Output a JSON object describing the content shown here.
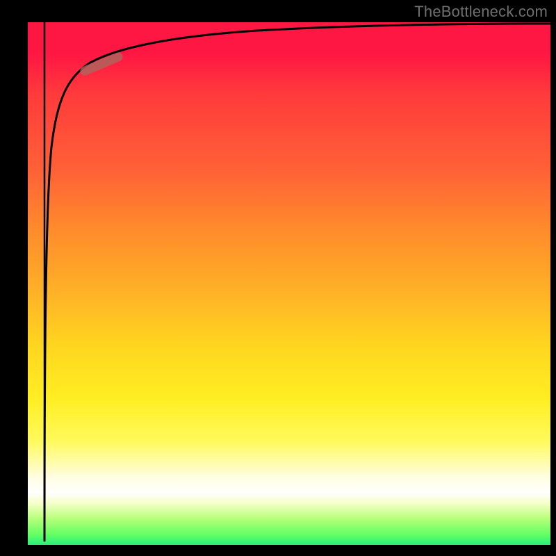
{
  "attribution": "TheBottleneck.com",
  "colors": {
    "page_bg": "#000000",
    "attribution_text": "#6f6f6f",
    "curve": "#000000",
    "marker": "#a9695f",
    "gradient_top": "#ff1744",
    "gradient_bottom": "#28f07a"
  },
  "chart_data": {
    "type": "line",
    "title": "",
    "xlabel": "",
    "ylabel": "",
    "xlim": [
      0,
      100
    ],
    "ylim": [
      0,
      100
    ],
    "series": [
      {
        "name": "curve",
        "x": [
          3,
          3.5,
          4,
          5,
          7,
          10,
          14,
          20,
          30,
          45,
          65,
          85,
          100
        ],
        "y": [
          0,
          50,
          70,
          80,
          86,
          90,
          92.5,
          94.5,
          96.2,
          97.4,
          98.3,
          98.9,
          99.3
        ]
      }
    ],
    "marker": {
      "x_range": [
        11,
        17
      ],
      "y_range": [
        91,
        93.5
      ]
    },
    "background": "vertical-gradient red→orange→yellow→white→green",
    "grid": false,
    "ticks": false,
    "legend": false
  }
}
